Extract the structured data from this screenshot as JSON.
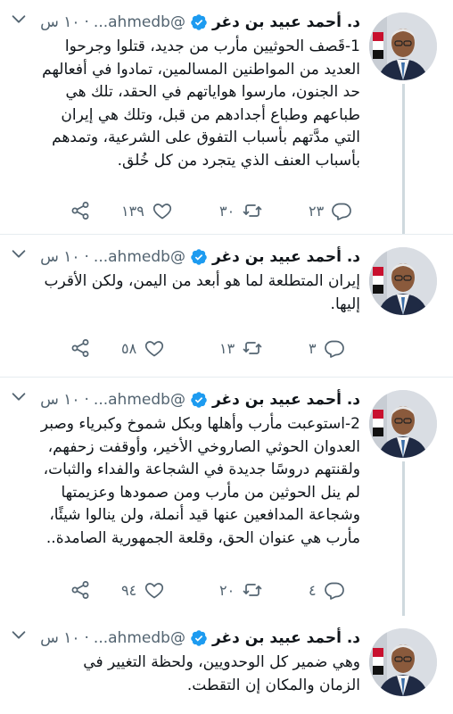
{
  "author": {
    "name": "د. أحمد عبيد بن دغر",
    "handle": "@ahmedb...",
    "separator": "·"
  },
  "icons": {
    "verified": "verified-badge-icon",
    "more": "chevron-down-icon",
    "reply": "reply-icon",
    "retweet": "retweet-icon",
    "like": "heart-icon",
    "share": "share-icon"
  },
  "colors": {
    "verified": "#1d9bf0",
    "muted": "#536471",
    "thread_line": "#cfd9de"
  },
  "tweets": [
    {
      "time": "١٠ س",
      "text": "1-قَصف الحوثيين مأرب من جديد، قتلوا وجرحوا\nالعديد من المواطنين المسالمين، تمادوا في أفعالهم\nحد الجنون، مارسوا هواياتهم في الحقد، تلك هي\nطباعهم وطباع أجدادهم من قبل، وتلك هي إيران\nالتي مدَّتهم بأسباب التفوق على الشرعية، وتمدهم\nبأسباب العنف الذي يتجرد من كل خُلق.",
      "replies": "٢٣",
      "retweets": "٣٠",
      "likes": "١٣٩"
    },
    {
      "time": "١٠ س",
      "text": "إيران المتطلعة لما هو أبعد من اليمن، ولكن الأقرب\nإليها.",
      "replies": "٣",
      "retweets": "١٣",
      "likes": "٥٨"
    },
    {
      "time": "١٠ س",
      "text": "2-استوعبت مأرب وأهلها وبكل شموخ وكبرياء وصبر\nالعدوان الحوثي الصاروخي الأخير، وأوقفت زحفهم،\nولقنتهم دروسًا جديدة في الشجاعة والفداء والثبات،\nلم ينل الحوثين من مأرب ومن صمودها وعزيمتها\nوشجاعة المدافعين عنها قيد أنملة، ولن ينالوا شيئًا،\nمأرب هي عنوان الحق، وقلعة الجمهورية الصامدة..",
      "replies": "٤",
      "retweets": "٢٠",
      "likes": "٩٤"
    },
    {
      "time": "١٠ س",
      "text": "وهي ضمير كل الوحدويين، ولحظة التغيير في\nالزمان والمكان إن التقطت."
    }
  ]
}
